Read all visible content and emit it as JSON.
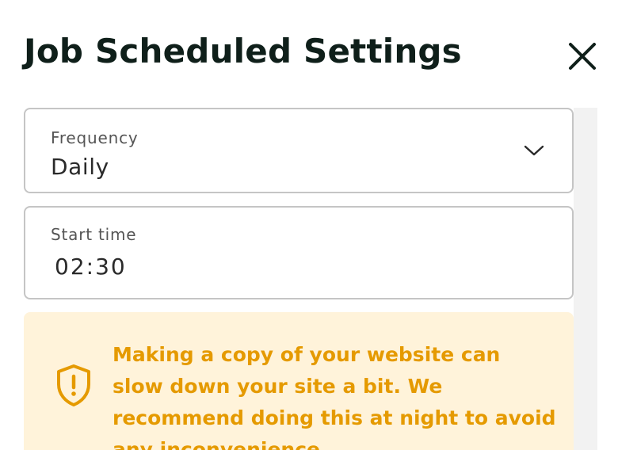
{
  "dialog": {
    "title": "Job Scheduled Settings",
    "close_icon": "close-icon"
  },
  "frequency": {
    "label": "Frequency",
    "value": "Daily",
    "dropdown_icon": "chevron-down-icon"
  },
  "start_time": {
    "label": "Start time",
    "value": "02:30"
  },
  "notice": {
    "icon": "shield-alert-icon",
    "text": "Making a copy of your website can slow down your site a bit. We recommend doing this at night to avoid any inconvenience."
  },
  "colors": {
    "title": "#0f1f1a",
    "warning_text": "#e59a00",
    "warning_bg": "#fff3da",
    "field_border": "#c5c5c5"
  }
}
